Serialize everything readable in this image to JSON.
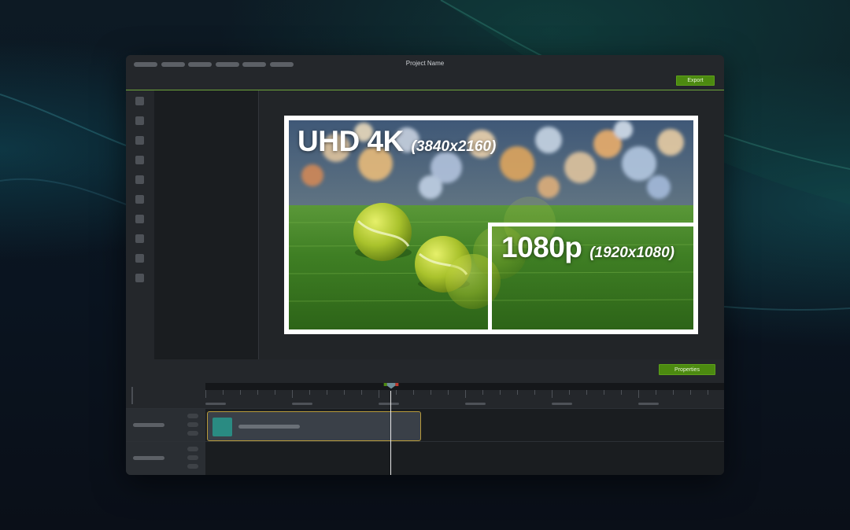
{
  "window": {
    "title": "Project Name"
  },
  "toolbar": {
    "export_label": "Export"
  },
  "preview": {
    "uhd_label": "UHD 4K",
    "uhd_resolution": "(3840x2160)",
    "hd_label": "1080p",
    "hd_resolution": "(1920x1080)"
  },
  "properties": {
    "button_label": "Properties"
  },
  "icons": [
    "tool-media-icon",
    "tool-library-icon",
    "tool-favorites-icon",
    "tool-annotations-icon",
    "tool-transitions-icon",
    "tool-behaviors-icon",
    "tool-animations-icon",
    "tool-cursor-icon",
    "tool-audio-icon",
    "tool-visual-effects-icon"
  ],
  "colors": {
    "accent": "#4c8a10",
    "accent_line": "#6ea63c",
    "clip_border": "#b89a3a",
    "clip_thumb": "#2a8b82"
  }
}
